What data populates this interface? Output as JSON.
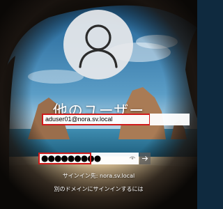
{
  "user_tile": {
    "avatar_icon": "user-silhouette-icon",
    "title": "他のユーザー"
  },
  "username_field": {
    "value": "aduser01@nora.sv.local",
    "highlight_color": "#d01a1a"
  },
  "password_field": {
    "masked_value": "●●●●●●●●●",
    "reveal_icon": "eye-icon",
    "submit_icon": "arrow-right-icon"
  },
  "sign_in_to": "サインイン先: nora.sv.local",
  "other_domain_link": "別のドメインにサインインするには",
  "colors": {
    "annotation_border": "#d01a1a",
    "text": "#ffffff"
  }
}
